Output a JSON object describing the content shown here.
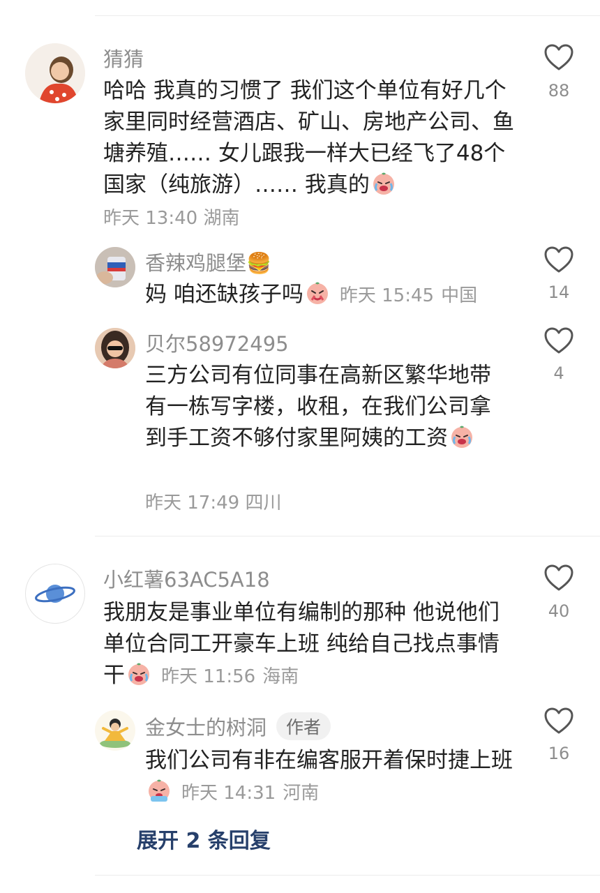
{
  "comments": [
    {
      "user": "猜猜",
      "text": "哈哈 我真的习惯了 我们这个单位有好几个家里同时经营酒店、矿山、房地产公司、鱼塘养殖…… 女儿跟我一样大已经飞了48个国家（纯旅游）…… 我真的",
      "time": "昨天 13:40",
      "location": "湖南",
      "likes": "88",
      "replies": [
        {
          "user": "香辣鸡腿堡🍔",
          "text": "妈 咱还缺孩子吗",
          "time": "昨天 15:45",
          "location": "中国",
          "likes": "14"
        },
        {
          "user": "贝尔58972495",
          "text": "三方公司有位同事在高新区繁华地带有一栋写字楼，收租，在我们公司拿到手工资不够付家里阿姨的工资",
          "time": "昨天 17:49",
          "location": "四川",
          "likes": "4"
        }
      ]
    },
    {
      "user": "小红薯63AC5A18",
      "text": "我朋友是事业单位有编制的那种 他说他们单位合同工开豪车上班 纯给自己找点事情干",
      "time": "昨天 11:56",
      "location": "海南",
      "likes": "40",
      "replies": [
        {
          "user": "金女士的树洞",
          "badge": "作者",
          "text": "我们公司有非在编客服开着保时捷上班",
          "time": "昨天 14:31",
          "location": "河南",
          "likes": "16"
        }
      ],
      "expand_label": "展开 2 条回复"
    }
  ],
  "icons": {
    "like": "heart-outline-icon",
    "emoji_cry": "crying-laugh-emoji",
    "emoji_pray": "pleading-emoji"
  },
  "colors": {
    "link": "#27406b",
    "meta": "#9a9a9a"
  }
}
